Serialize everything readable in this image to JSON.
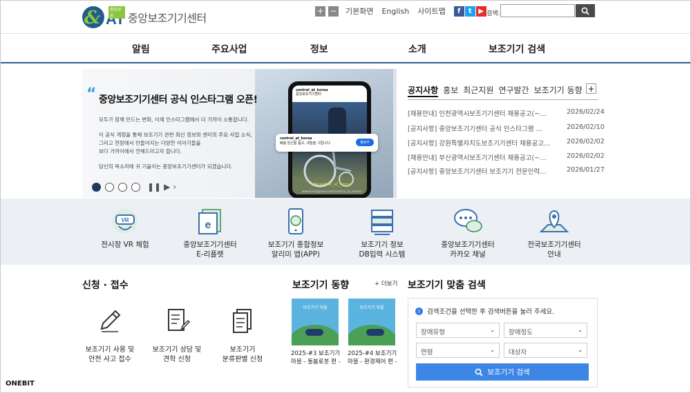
{
  "header": {
    "logo_tag": "중앙보조",
    "logo_at": "AT",
    "logo_text": "중앙보조기기센터",
    "zoom_in": "+",
    "zoom_out": "−",
    "default_view": "기본화면",
    "english": "English",
    "sitemap": "사이트맵",
    "search_label": "검색:",
    "search_value": ""
  },
  "nav": [
    "알림",
    "주요사업",
    "정보",
    "소개",
    "보조기기 검색"
  ],
  "banner": {
    "title": "중앙보조기기센터 공식 인스타그램 오픈!",
    "p1": "모두가 함께 만드는 변화, 이제 인스타그램에서 더 가까이 소통합니다.",
    "p2a": "이 공식 계정을 통해 보조기기 관련 최신 정보와 센터의 주요 사업 소식,",
    "p2b": "그리고 현장에서 만들어지는 다양한 이야기들을",
    "p2c": "보다 가까이에서 전해드리고자 합니다.",
    "p3": "당신의 목소리에 귀 기울이는 중앙보조기기센터가 되겠습니다.",
    "phone_account": "central_at_korea",
    "phone_name": "중앙보조기기센터",
    "popup_name": "central_at_korea",
    "popup_sub": "배움 당신을 돕고, 내일을 그립니다.",
    "popup_follow": "팔로우",
    "hashtag": "@central_at_korea",
    "url": "www.instagram.com/central_at_korea/"
  },
  "notice": {
    "tabs": [
      "공지사항",
      "홍보",
      "최근지원",
      "연구발간",
      "보조기기 동향"
    ],
    "plus": "+",
    "items": [
      {
        "title": "[채용안내] 인천광역시보조기기센터 채용공고(~…",
        "date": "2026/02/24"
      },
      {
        "title": "[공지사항] 중앙보조기기센터 공식 인스타그램 …",
        "date": "2026/02/10"
      },
      {
        "title": "[공지사항] 강원특별자치도보조기기센터 채용공고…",
        "date": "2026/02/02"
      },
      {
        "title": "[채용안내] 부산광역시보조기기센터 채용공고(~…",
        "date": "2026/02/02"
      },
      {
        "title": "[공지사항] 중앙보조기기센터 보조기기 전문인력…",
        "date": "2026/01/27"
      }
    ]
  },
  "quick": [
    {
      "l1": "전시장 VR 체험",
      "l2": "",
      "icon": "vr-headset-icon"
    },
    {
      "l1": "중앙보조기기센터",
      "l2": "E-리플렛",
      "icon": "e-leaflet-icon"
    },
    {
      "l1": "보조기기 종합정보",
      "l2": "알리미 앱(APP)",
      "icon": "mobile-app-icon"
    },
    {
      "l1": "보조기기 정보",
      "l2": "DB입력 시스템",
      "icon": "database-server-icon"
    },
    {
      "l1": "중앙보조기기센터",
      "l2": "카카오 채널",
      "icon": "chat-bubble-icon"
    },
    {
      "l1": "전국보조기기센터",
      "l2": "안내",
      "icon": "map-pin-icon"
    }
  ],
  "apply": {
    "title": "신청 · 접수",
    "items": [
      {
        "l1": "보조기기 사용 및",
        "l2": "안전 사고 접수"
      },
      {
        "l1": "보조기기 상담 및",
        "l2": "견학 신청"
      },
      {
        "l1": "보조기기",
        "l2": "분류판별 신청"
      }
    ]
  },
  "trends": {
    "title": "보조기기 동향",
    "more": "+ 더보기",
    "items": [
      {
        "thumb": "보조기기 마블",
        "l1": "2025-#3 보조기기",
        "l2": "마블 - 돌봄로봇 편 -"
      },
      {
        "thumb": "보조기기 마블",
        "l1": "2025-#4 보조기기",
        "l2": "마블 - 환경제어 편 -"
      }
    ]
  },
  "finder": {
    "title": "보조기기 맞춤 검색",
    "hint": "검색조건을 선택한 후 검색버튼을 눌러 주세요.",
    "selects": [
      "장애유형",
      "장애정도",
      "연령",
      "대상자"
    ],
    "button": "보조기기 검색"
  },
  "watermark": "ONEBIT",
  "colors": {
    "brand_blue": "#1f5c8f",
    "brand_green": "#8cc63f",
    "nav_line": "#2b5a8a",
    "search_button": "#3d86e6",
    "facebook": "#3b5998",
    "twitter": "#1da1f2",
    "youtube": "#e52d27"
  }
}
